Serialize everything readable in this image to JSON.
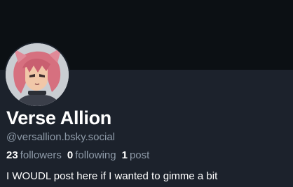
{
  "profile": {
    "display_name": "Verse Allion",
    "handle": "@versallion.bsky.social",
    "bio": "I WOUDL post here if I wanted to gimme a bit",
    "avatar_icon": "anime-avatar-icon"
  },
  "stats": {
    "followers_count": "23",
    "followers_label": "followers",
    "following_count": "0",
    "following_label": "following",
    "posts_count": "1",
    "posts_label": "post"
  },
  "colors": {
    "background": "#1c222c",
    "banner": "#0c1014",
    "primary_text": "#ffffff",
    "secondary_text": "#8e9aa8"
  }
}
